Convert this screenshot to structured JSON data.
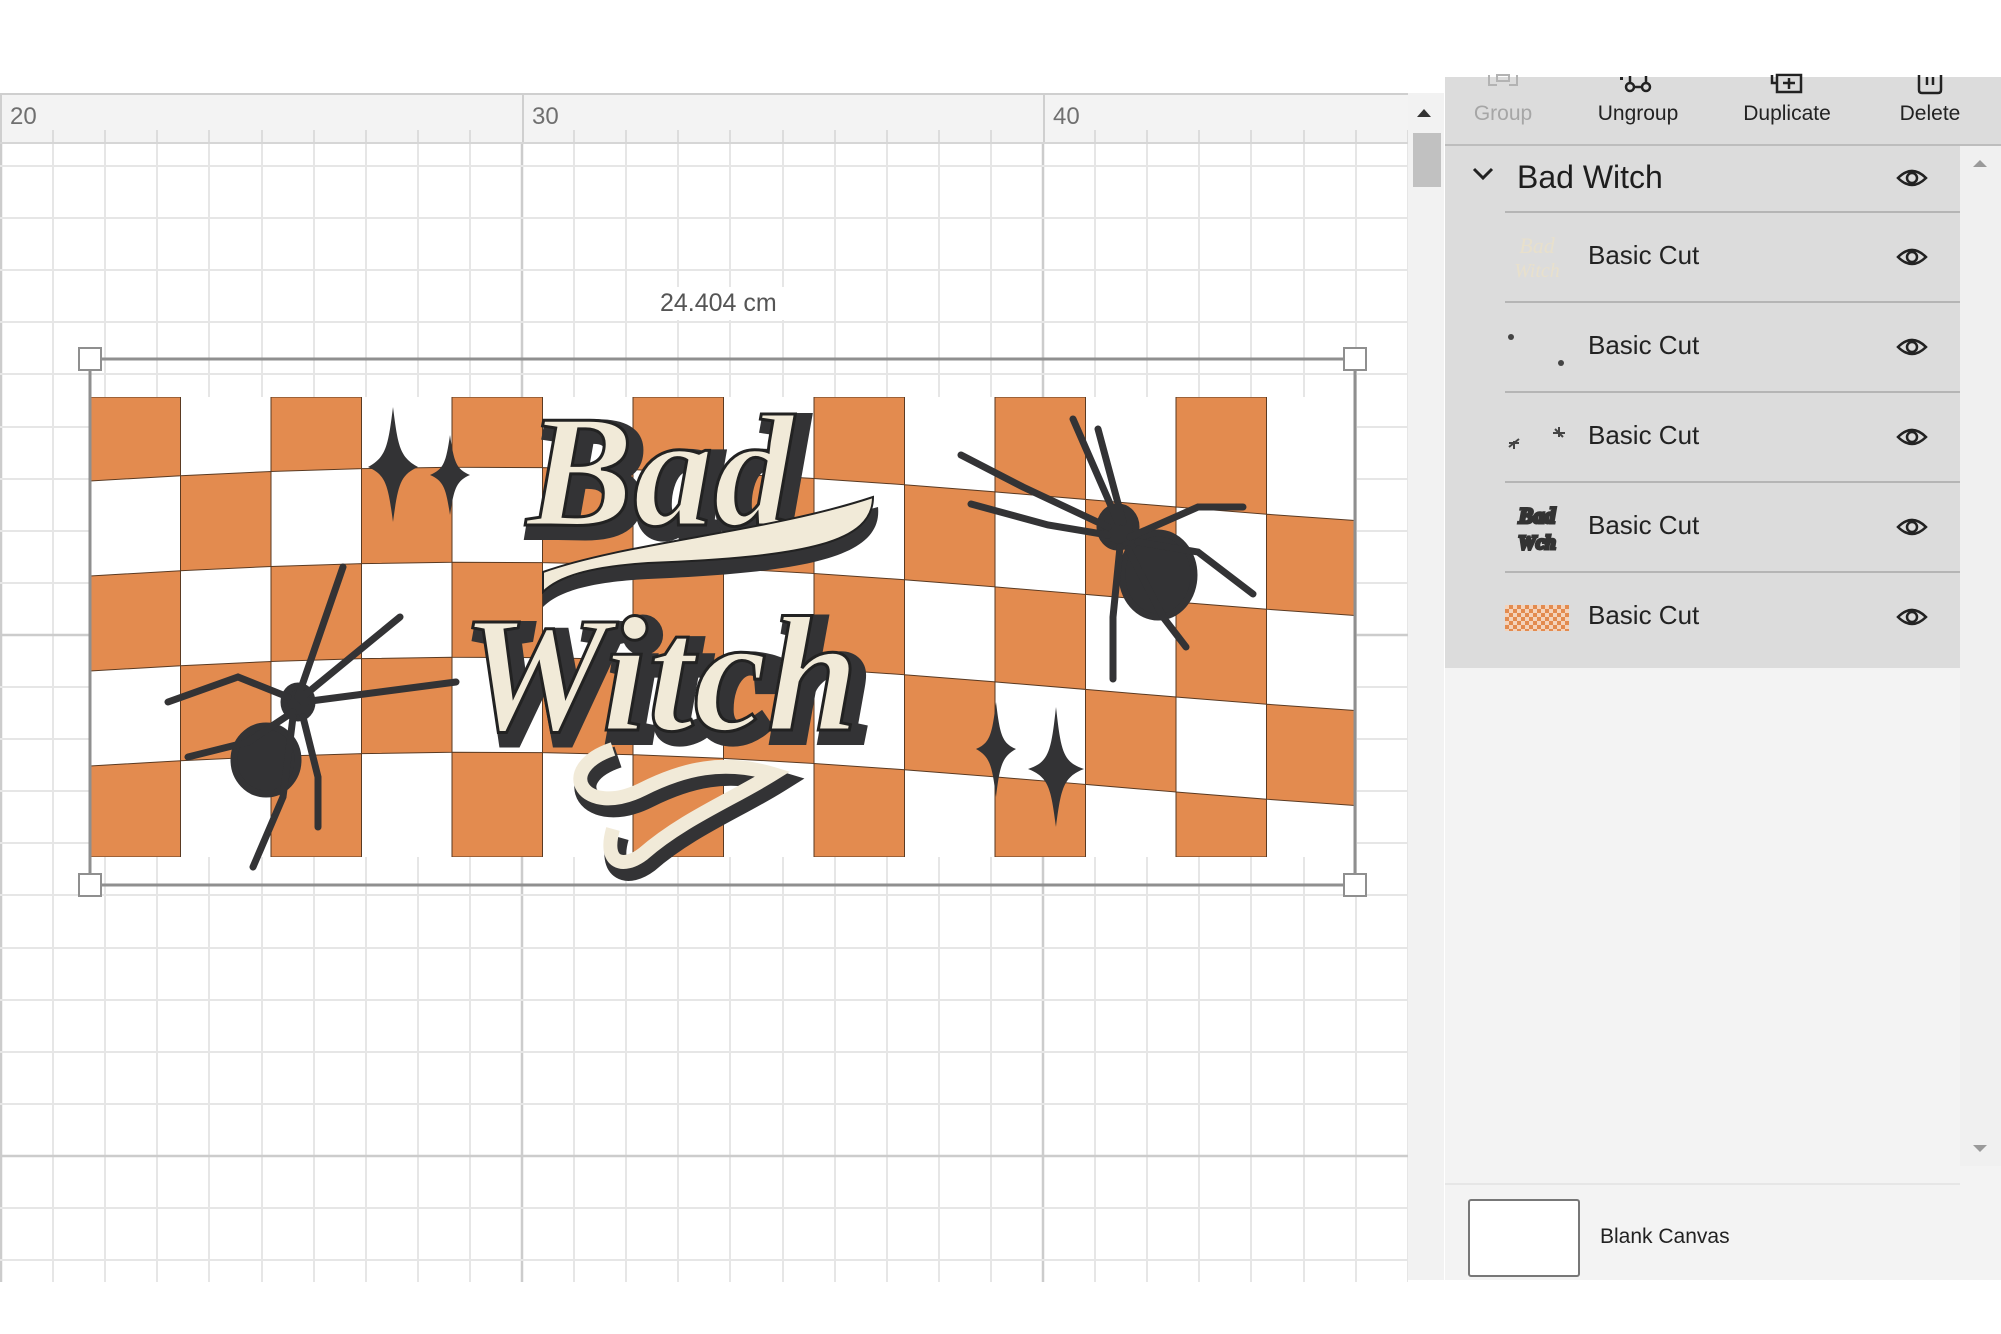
{
  "ruler": {
    "labels": [
      "20",
      "30",
      "40"
    ],
    "unit": "cm"
  },
  "canvas": {
    "dimension_label": "24.404 cm",
    "design_colors": {
      "orange": "#E38B4F",
      "dark": "#333335",
      "cream": "#F1EAD8",
      "white": "#FFFFFF"
    },
    "selection_color": "#8f8f8f"
  },
  "toolbar": {
    "group_label": "Group",
    "ungroup_label": "Ungroup",
    "duplicate_label": "Duplicate",
    "delete_label": "Delete"
  },
  "layers": {
    "group": {
      "name": "Bad Witch",
      "expanded": true,
      "visible": true
    },
    "items": [
      {
        "label": "Basic Cut",
        "thumbnail": "cream-lettering",
        "visible": true
      },
      {
        "label": "Basic Cut",
        "thumbnail": "small-sparkles",
        "visible": true
      },
      {
        "label": "Basic Cut",
        "thumbnail": "spiders",
        "visible": true
      },
      {
        "label": "Basic Cut",
        "thumbnail": "dark-lettering-shadow",
        "visible": true
      },
      {
        "label": "Basic Cut",
        "thumbnail": "orange-checker",
        "visible": true
      }
    ]
  },
  "canvas_settings": {
    "label": "Blank Canvas"
  }
}
